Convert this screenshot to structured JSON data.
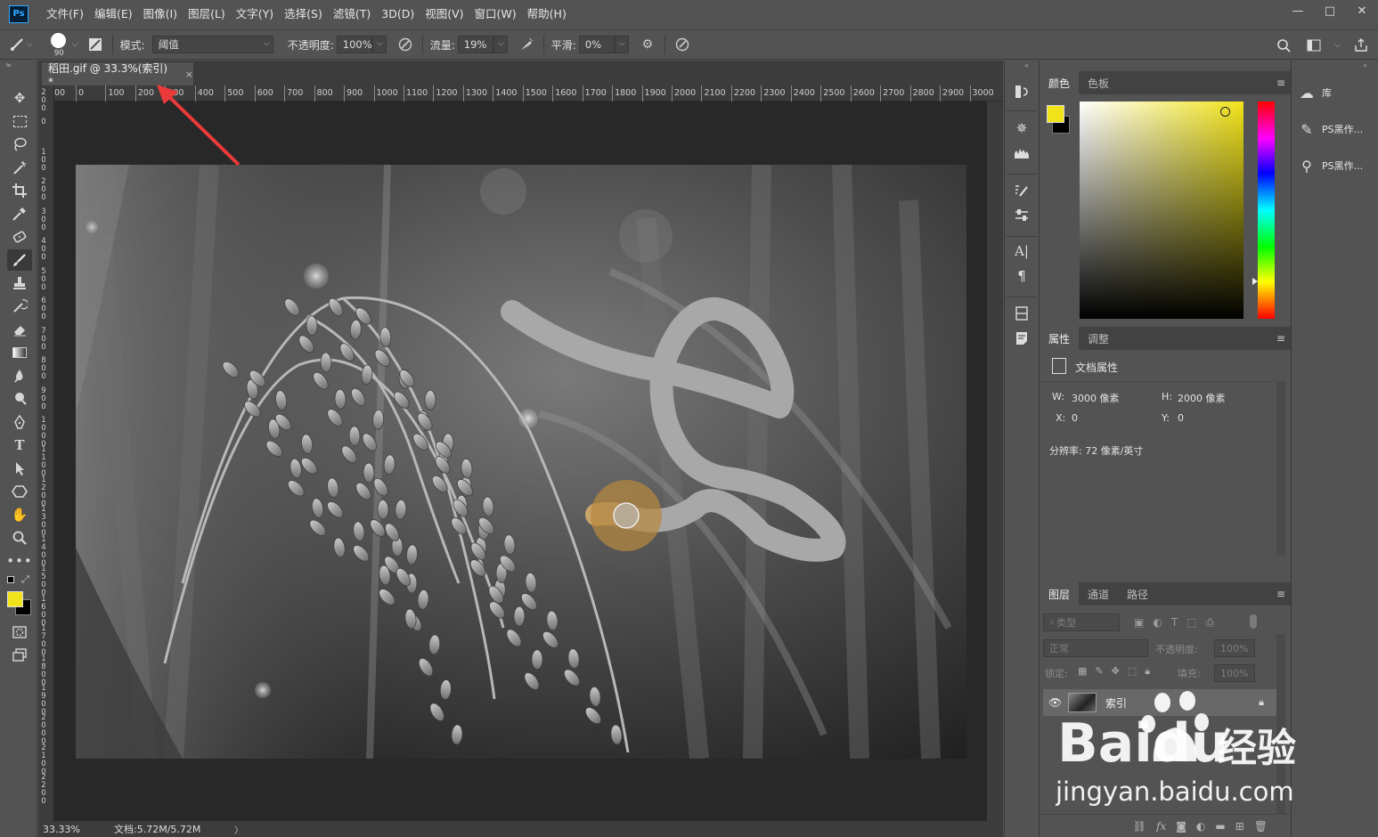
{
  "app": {
    "logo": "Ps"
  },
  "menu": [
    "文件(F)",
    "编辑(E)",
    "图像(I)",
    "图层(L)",
    "文字(Y)",
    "选择(S)",
    "滤镜(T)",
    "3D(D)",
    "视图(V)",
    "窗口(W)",
    "帮助(H)"
  ],
  "window_controls": {
    "minimize": "—",
    "restore": "□",
    "close": "✕"
  },
  "options": {
    "brush_size": "90",
    "mode_label": "模式:",
    "mode_value": "阈值",
    "opacity_label": "不透明度:",
    "opacity_value": "100%",
    "flow_label": "流量:",
    "flow_value": "19%",
    "smooth_label": "平滑:",
    "smooth_value": "0%"
  },
  "document": {
    "tab_title": "稻田.gif @ 33.3%(索引) *",
    "tab_close": "×",
    "ruler_h": [
      "00",
      "0",
      "100",
      "200",
      "300",
      "400",
      "500",
      "600",
      "700",
      "800",
      "900",
      "1000",
      "1100",
      "1200",
      "1300",
      "1400",
      "1500",
      "1600",
      "1700",
      "1800",
      "1900",
      "2000",
      "2100",
      "2200",
      "2300",
      "2400",
      "2500",
      "2600",
      "2700",
      "2800",
      "2900",
      "3000"
    ],
    "ruler_v": [
      "2 0 0",
      "0",
      "1 0 0",
      "2 0 0",
      "3 0 0",
      "4 0 0",
      "5 0 0",
      "6 0 0",
      "7 0 0",
      "8 0 0",
      "9 0 0",
      "1 0 0 0",
      "1 1 0 0",
      "1 2 0 0",
      "1 3 0 0",
      "1 4 0 0",
      "1 5 0 0",
      "1 6 0 0",
      "1 7 0 0",
      "1 8 0 0",
      "1 9 0 0",
      "2 0 0 0",
      "2 1 0 0",
      "2 2 0 0"
    ],
    "zoom": "33.33%",
    "doc_size": "文档:5.72M/5.72M",
    "status_arrow": "〉"
  },
  "colors": {
    "foreground": "#f1e31a",
    "background": "#000000",
    "hue_marker": "#f1e31a",
    "brush_cursor": "#b7883f"
  },
  "color_panel": {
    "tabs": [
      "颜色",
      "色板"
    ],
    "menu": "≡"
  },
  "properties_panel": {
    "tabs": [
      "属性",
      "调整"
    ],
    "menu": "≡",
    "section_title": "文档属性",
    "w_label": "W:",
    "w_value": "3000 像素",
    "h_label": "H:",
    "h_value": "2000 像素",
    "x_label": "X:",
    "x_value": "0",
    "y_label": "Y:",
    "y_value": "0",
    "resolution": "分辨率: 72 像素/英寸"
  },
  "layers_panel": {
    "tabs": [
      "图层",
      "通道",
      "路径"
    ],
    "menu": "≡",
    "filter_placeholder": "类型",
    "blend_mode": "正常",
    "opacity_label": "不透明度:",
    "opacity_value": "100%",
    "lock_label": "锁定:",
    "fill_label": "填充:",
    "fill_value": "100%",
    "layer_name": "索引",
    "footer_icons": [
      "link-icon",
      "fx-icon",
      "mask-icon",
      "adjustment-icon",
      "folder-icon",
      "new-layer-icon",
      "trash-icon"
    ],
    "fx_label": "fx"
  },
  "library": {
    "items": [
      {
        "label": "库",
        "icon": "cloud-library-icon"
      },
      {
        "label": "PS黑作...",
        "icon": "brush-preset-icon"
      },
      {
        "label": "PS黑作...",
        "icon": "clone-source-icon"
      }
    ]
  },
  "watermark": {
    "brand": "Baidu",
    "cn": "经验",
    "url": "jingyan.baidu.com"
  }
}
